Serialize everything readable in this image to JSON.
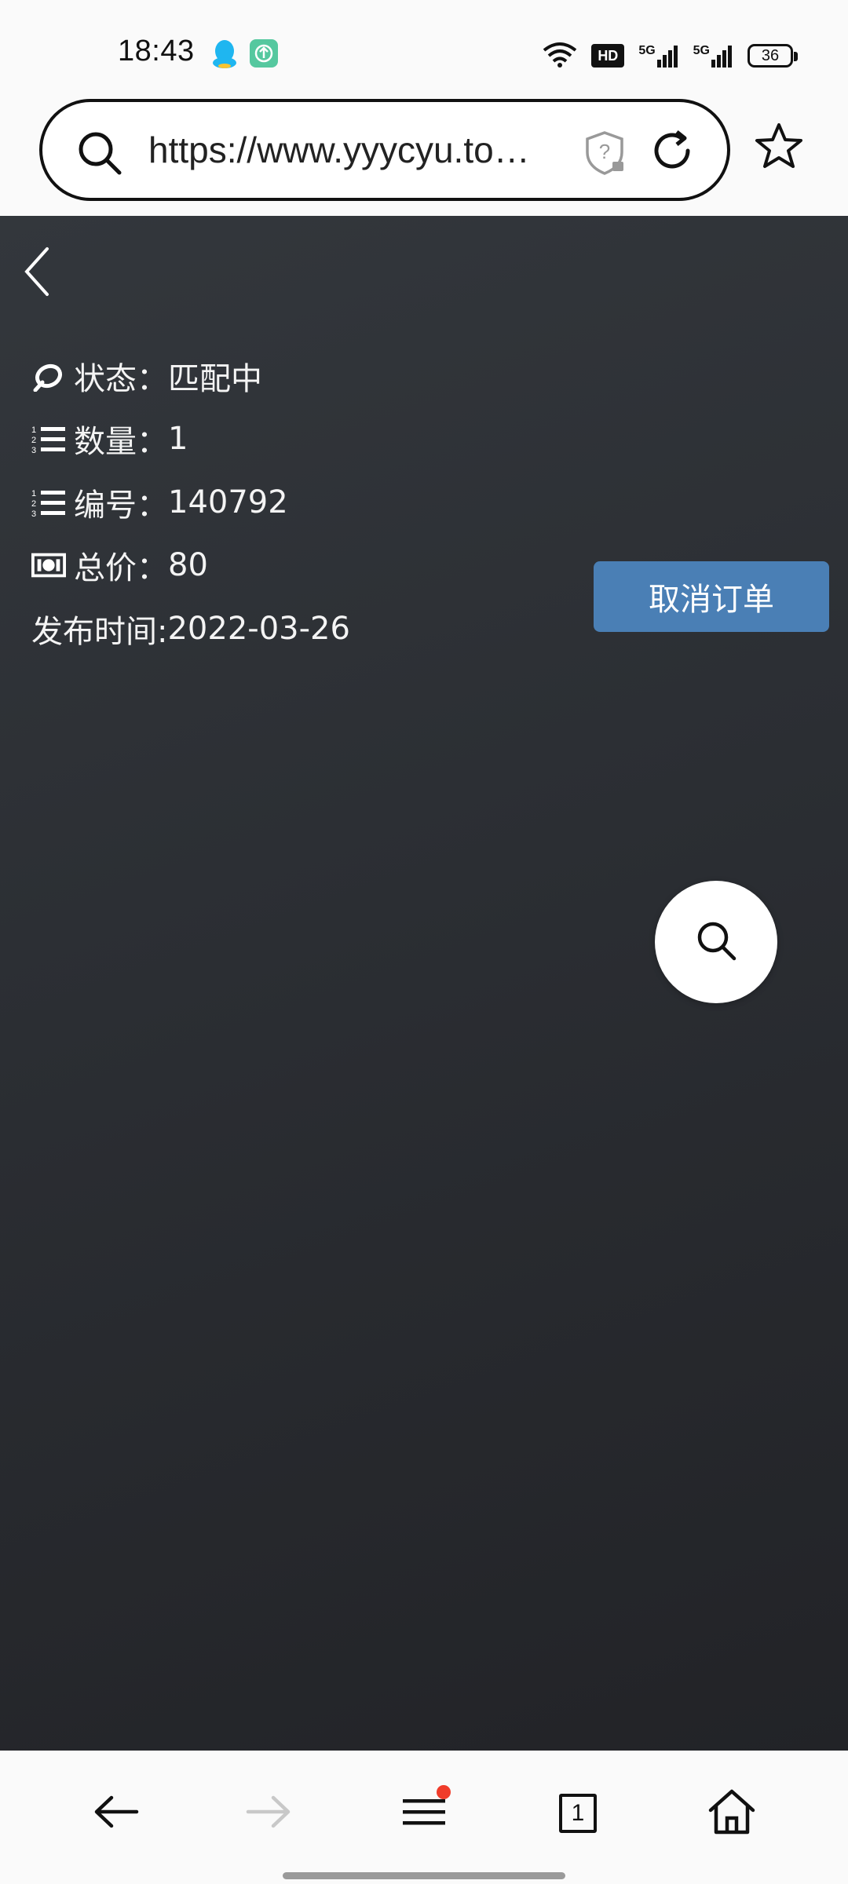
{
  "status_bar": {
    "time": "18:43",
    "battery": "36",
    "network_badge": "HD",
    "signal_label_1": "5G",
    "signal_label_2": "5G"
  },
  "browser": {
    "url": "https://www.yyycyu.to…"
  },
  "order": {
    "status_label": "状态：",
    "status_value": "匹配中",
    "quantity_label": "数量：",
    "quantity_value": "1",
    "number_label": "编号：",
    "number_value": "140792",
    "price_label": "总价：",
    "price_value": "80",
    "date_label": "发布时间:",
    "date_value": "2022-03-26",
    "cancel_button": "取消订单"
  },
  "bottom_nav": {
    "tab_count": "1"
  },
  "colors": {
    "accent": "#4a7fb5",
    "background_dark": "#2b2e33",
    "notification_dot": "#f03c2a"
  }
}
